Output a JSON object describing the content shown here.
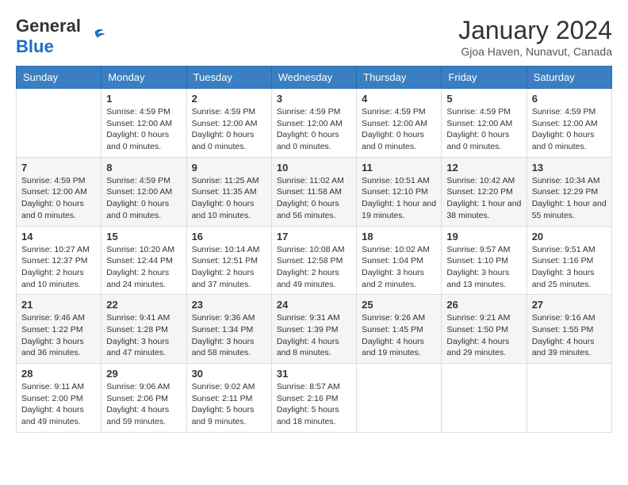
{
  "header": {
    "logo_general": "General",
    "logo_blue": "Blue",
    "title": "January 2024",
    "location": "Gjoa Haven, Nunavut, Canada"
  },
  "days_of_week": [
    "Sunday",
    "Monday",
    "Tuesday",
    "Wednesday",
    "Thursday",
    "Friday",
    "Saturday"
  ],
  "weeks": [
    [
      {
        "day": "",
        "info": ""
      },
      {
        "day": "1",
        "info": "Sunrise: 4:59 PM\nSunset: 12:00 AM\nDaylight: 0 hours\nand 0 minutes."
      },
      {
        "day": "2",
        "info": "Sunrise: 4:59 PM\nSunset: 12:00 AM\nDaylight: 0 hours\nand 0 minutes."
      },
      {
        "day": "3",
        "info": "Sunrise: 4:59 PM\nSunset: 12:00 AM\nDaylight: 0 hours\nand 0 minutes."
      },
      {
        "day": "4",
        "info": "Sunrise: 4:59 PM\nSunset: 12:00 AM\nDaylight: 0 hours\nand 0 minutes."
      },
      {
        "day": "5",
        "info": "Sunrise: 4:59 PM\nSunset: 12:00 AM\nDaylight: 0 hours\nand 0 minutes."
      },
      {
        "day": "6",
        "info": "Sunrise: 4:59 PM\nSunset: 12:00 AM\nDaylight: 0 hours\nand 0 minutes."
      }
    ],
    [
      {
        "day": "7",
        "info": "Sunrise: 4:59 PM\nSunset: 12:00 AM\nDaylight: 0 hours\nand 0 minutes."
      },
      {
        "day": "8",
        "info": "Sunrise: 4:59 PM\nSunset: 12:00 AM\nDaylight: 0 hours\nand 0 minutes."
      },
      {
        "day": "9",
        "info": "Sunrise: 11:25 AM\nSunset: 11:35 AM\nDaylight: 0 hours\nand 10 minutes."
      },
      {
        "day": "10",
        "info": "Sunrise: 11:02 AM\nSunset: 11:58 AM\nDaylight: 0 hours\nand 56 minutes."
      },
      {
        "day": "11",
        "info": "Sunrise: 10:51 AM\nSunset: 12:10 PM\nDaylight: 1 hour and\n19 minutes."
      },
      {
        "day": "12",
        "info": "Sunrise: 10:42 AM\nSunset: 12:20 PM\nDaylight: 1 hour and\n38 minutes."
      },
      {
        "day": "13",
        "info": "Sunrise: 10:34 AM\nSunset: 12:29 PM\nDaylight: 1 hour and\n55 minutes."
      }
    ],
    [
      {
        "day": "14",
        "info": "Sunrise: 10:27 AM\nSunset: 12:37 PM\nDaylight: 2 hours\nand 10 minutes."
      },
      {
        "day": "15",
        "info": "Sunrise: 10:20 AM\nSunset: 12:44 PM\nDaylight: 2 hours\nand 24 minutes."
      },
      {
        "day": "16",
        "info": "Sunrise: 10:14 AM\nSunset: 12:51 PM\nDaylight: 2 hours\nand 37 minutes."
      },
      {
        "day": "17",
        "info": "Sunrise: 10:08 AM\nSunset: 12:58 PM\nDaylight: 2 hours\nand 49 minutes."
      },
      {
        "day": "18",
        "info": "Sunrise: 10:02 AM\nSunset: 1:04 PM\nDaylight: 3 hours\nand 2 minutes."
      },
      {
        "day": "19",
        "info": "Sunrise: 9:57 AM\nSunset: 1:10 PM\nDaylight: 3 hours\nand 13 minutes."
      },
      {
        "day": "20",
        "info": "Sunrise: 9:51 AM\nSunset: 1:16 PM\nDaylight: 3 hours\nand 25 minutes."
      }
    ],
    [
      {
        "day": "21",
        "info": "Sunrise: 9:46 AM\nSunset: 1:22 PM\nDaylight: 3 hours\nand 36 minutes."
      },
      {
        "day": "22",
        "info": "Sunrise: 9:41 AM\nSunset: 1:28 PM\nDaylight: 3 hours\nand 47 minutes."
      },
      {
        "day": "23",
        "info": "Sunrise: 9:36 AM\nSunset: 1:34 PM\nDaylight: 3 hours\nand 58 minutes."
      },
      {
        "day": "24",
        "info": "Sunrise: 9:31 AM\nSunset: 1:39 PM\nDaylight: 4 hours\nand 8 minutes."
      },
      {
        "day": "25",
        "info": "Sunrise: 9:26 AM\nSunset: 1:45 PM\nDaylight: 4 hours\nand 19 minutes."
      },
      {
        "day": "26",
        "info": "Sunrise: 9:21 AM\nSunset: 1:50 PM\nDaylight: 4 hours\nand 29 minutes."
      },
      {
        "day": "27",
        "info": "Sunrise: 9:16 AM\nSunset: 1:55 PM\nDaylight: 4 hours\nand 39 minutes."
      }
    ],
    [
      {
        "day": "28",
        "info": "Sunrise: 9:11 AM\nSunset: 2:00 PM\nDaylight: 4 hours\nand 49 minutes."
      },
      {
        "day": "29",
        "info": "Sunrise: 9:06 AM\nSunset: 2:06 PM\nDaylight: 4 hours\nand 59 minutes."
      },
      {
        "day": "30",
        "info": "Sunrise: 9:02 AM\nSunset: 2:11 PM\nDaylight: 5 hours\nand 9 minutes."
      },
      {
        "day": "31",
        "info": "Sunrise: 8:57 AM\nSunset: 2:16 PM\nDaylight: 5 hours\nand 18 minutes."
      },
      {
        "day": "",
        "info": ""
      },
      {
        "day": "",
        "info": ""
      },
      {
        "day": "",
        "info": ""
      }
    ]
  ]
}
